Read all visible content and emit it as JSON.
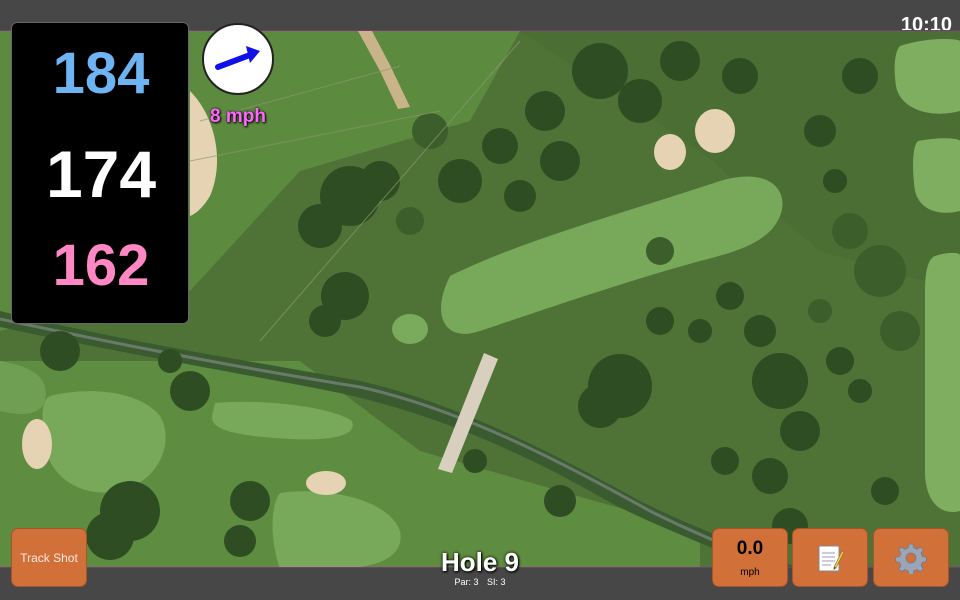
{
  "status": {
    "time": "10:10"
  },
  "distances": {
    "back": "184",
    "middle": "174",
    "front": "162",
    "colors": {
      "back": "#6eb4f2",
      "middle": "#ffffff",
      "front": "#ff88c4"
    }
  },
  "wind": {
    "speed_label": "8 mph",
    "arrow_icon": "wind-direction-arrow-icon",
    "arrow_color": "#1010e8"
  },
  "buttons": {
    "track_shot": "Track Shot",
    "speed_value": "0.0",
    "speed_unit": "mph",
    "notes_icon": "notepad-icon",
    "settings_icon": "gear-icon",
    "accent": "#d2703a"
  },
  "hole": {
    "title": "Hole 9",
    "par": "Par: 3",
    "stroke_index": "SI: 3"
  }
}
